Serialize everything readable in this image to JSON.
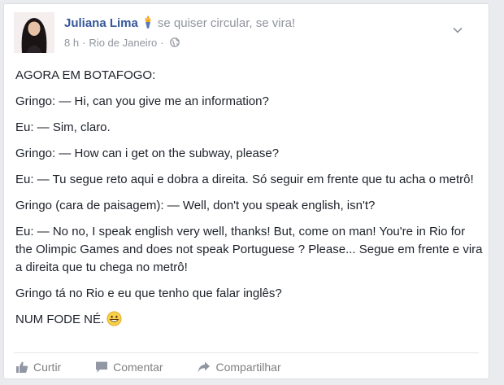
{
  "post": {
    "author": "Juliana Lima",
    "feeling": "se quiser circular, se vira!",
    "time": "8 h",
    "separator": "·",
    "location": "Rio de Janeiro",
    "separator2": "·",
    "icons": {
      "feeling": "torch-icon",
      "privacy": "globe-icon",
      "menu": "chevron-down-icon",
      "emoji": "grinning-face-icon"
    },
    "lines": [
      "AGORA EM BOTAFOGO:",
      "Gringo: — Hi, can you give me an information?",
      "Eu: — Sim, claro.",
      "Gringo: — How can i get on the subway, please?",
      "Eu: — Tu segue reto aqui e dobra a direita. Só seguir em frente que tu acha o metrô!",
      "Gringo (cara de paisagem): — Well, don't you speak english, isn't?",
      "Eu: — No no, I speak english very well, thanks! But, come on man! You're in Rio for the Olimpic Games and does not speak Portuguese ? Please... Segue em frente e vira a direita que tu chega no metrô!",
      "Gringo tá no Rio e eu que tenho que falar inglês?",
      "NUM FODE NÉ."
    ]
  },
  "actions": {
    "like": "Curtir",
    "comment": "Comentar",
    "share": "Compartilhar"
  },
  "colors": {
    "author": "#365899",
    "meta": "#90949c",
    "text": "#1d2129",
    "actions": "#7f7f7f"
  }
}
